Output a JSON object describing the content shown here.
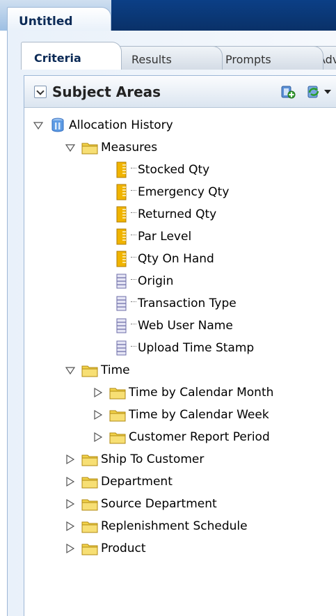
{
  "document_tab": {
    "title": "Untitled"
  },
  "tabs": [
    {
      "label": "Criteria"
    },
    {
      "label": "Results"
    },
    {
      "label": "Prompts"
    },
    {
      "label": "Adv"
    }
  ],
  "subject_areas": {
    "title": "Subject Areas",
    "root": {
      "label": "Allocation History",
      "icon": "subject-area-icon"
    },
    "measures_folder": {
      "label": "Measures"
    },
    "measures": [
      {
        "label": "Stocked Qty",
        "icon": "measure-column-icon"
      },
      {
        "label": "Emergency Qty",
        "icon": "measure-column-icon"
      },
      {
        "label": "Returned Qty",
        "icon": "measure-column-icon"
      },
      {
        "label": "Par Level",
        "icon": "measure-column-icon"
      },
      {
        "label": "Qty On Hand",
        "icon": "measure-column-icon"
      },
      {
        "label": "Origin",
        "icon": "attribute-column-icon"
      },
      {
        "label": "Transaction Type",
        "icon": "attribute-column-icon"
      },
      {
        "label": "Web User Name",
        "icon": "attribute-column-icon"
      },
      {
        "label": "Upload Time Stamp",
        "icon": "attribute-column-icon"
      }
    ],
    "time_folder": {
      "label": "Time"
    },
    "time_children": [
      {
        "label": "Time by Calendar Month"
      },
      {
        "label": "Time by Calendar Week"
      },
      {
        "label": "Customer Report Period"
      }
    ],
    "top_folders": [
      {
        "label": "Ship To Customer"
      },
      {
        "label": "Department"
      },
      {
        "label": "Source Department"
      },
      {
        "label": "Replenishment Schedule"
      },
      {
        "label": "Product"
      }
    ]
  },
  "colors": {
    "header_dark": "#0b3f86",
    "folder": "#f2d24a",
    "measure": "#f0b400",
    "attribute": "#8a8ac0"
  }
}
